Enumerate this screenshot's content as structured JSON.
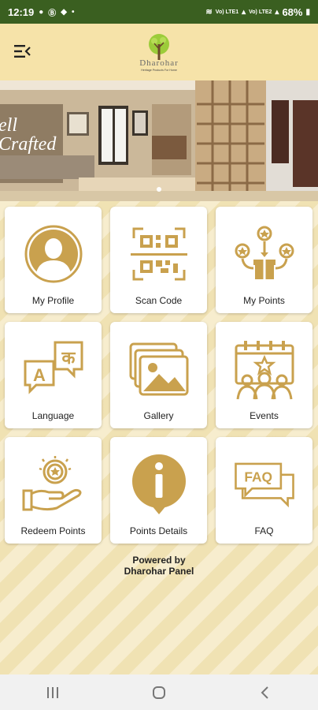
{
  "status_bar": {
    "time": "12:19",
    "network_label_1": "Vo) LTE1",
    "network_label_2": "Vo) LTE2",
    "battery": "68%"
  },
  "header": {
    "logo_name": "Dharohar",
    "logo_tagline": "Heritage Products For Home"
  },
  "banner": {
    "text_line1": "ell",
    "text_line2": "Crafted"
  },
  "tiles": [
    {
      "label": "My Profile",
      "icon": "profile-icon"
    },
    {
      "label": "Scan Code",
      "icon": "qr-code-icon"
    },
    {
      "label": "My Points",
      "icon": "points-gift-icon"
    },
    {
      "label": "Language",
      "icon": "language-icon"
    },
    {
      "label": "Gallery",
      "icon": "gallery-icon"
    },
    {
      "label": "Events",
      "icon": "events-icon"
    },
    {
      "label": "Redeem Points",
      "icon": "redeem-hand-coin-icon"
    },
    {
      "label": "Points Details",
      "icon": "info-icon"
    },
    {
      "label": "FAQ",
      "icon": "faq-icon"
    }
  ],
  "footer": {
    "powered_line1": "Powered by",
    "powered_line2": "Dharohar Panel"
  },
  "colors": {
    "status_bar": "#3a5f20",
    "header_bg": "#f6e3a9",
    "icon_gold": "#c9a14e",
    "page_bg": "#f4e9c2"
  }
}
